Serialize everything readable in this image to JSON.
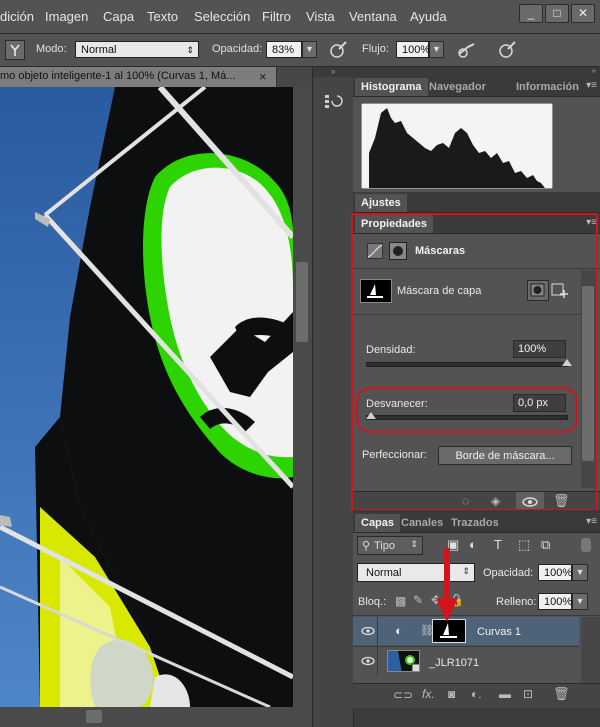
{
  "menu": {
    "items": [
      "dición",
      "Imagen",
      "Capa",
      "Texto",
      "Selección",
      "Filtro",
      "Vista",
      "Ventana",
      "Ayuda"
    ],
    "window_buttons": [
      "_",
      "□",
      "✕"
    ]
  },
  "options_bar": {
    "mode_label": "Modo:",
    "mode_value": "Normal",
    "opacity_label": "Opacidad:",
    "opacity_value": "83%",
    "flow_label": "Flujo:",
    "flow_value": "100%"
  },
  "document": {
    "tab_title": "mo objeto inteligente-1 al 100% (Curvas 1, Má...",
    "close": "×"
  },
  "panels": {
    "top_tabs": [
      "Histograma",
      "Navegador",
      "Información"
    ],
    "adjustments_tab": "Ajustes",
    "properties_tab": "Propiedades",
    "properties": {
      "section_title": "Máscaras",
      "mask_label": "Máscara de capa",
      "density_label": "Densidad:",
      "density_value": "100%",
      "density_level": 1.0,
      "feather_label": "Desvanecer:",
      "feather_value": "0,0 px",
      "feather_level": 0.0,
      "refine_label": "Perfeccionar:",
      "refine_button": "Borde de máscara..."
    },
    "layers_tabs": [
      "Capas",
      "Canales",
      "Trazados"
    ],
    "layers": {
      "filter_label": "Tipo",
      "blend_mode": "Normal",
      "opacity_label": "Opacidad:",
      "opacity_value": "100%",
      "lock_label": "Bloq.:",
      "fill_label": "Relleno:",
      "fill_value": "100%",
      "rows": [
        {
          "name": "Curvas 1"
        },
        {
          "name": "_JLR1071"
        }
      ]
    }
  },
  "colors": {
    "accent": "#d4141c",
    "selected_layer": "#4f6378",
    "sky": "#2f5fa3",
    "green": "#28c800"
  }
}
